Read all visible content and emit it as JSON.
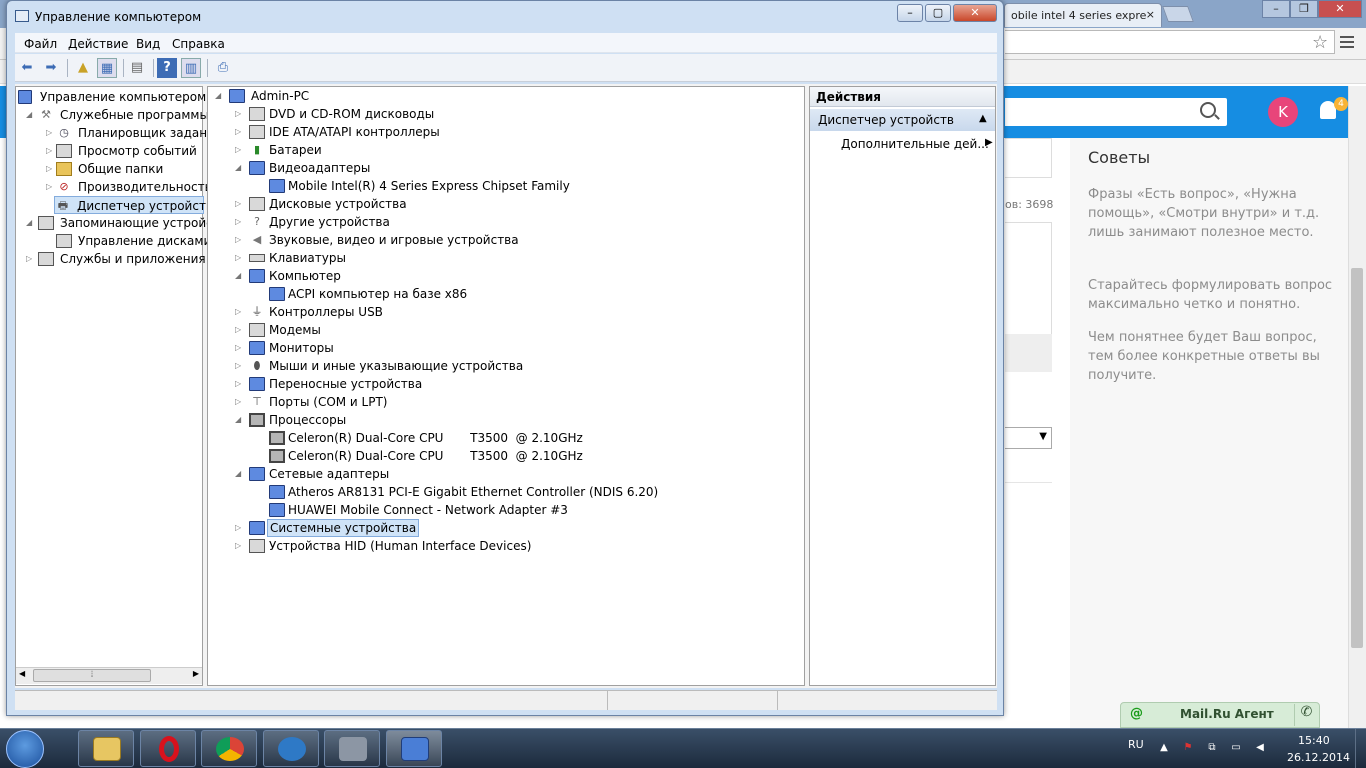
{
  "browser": {
    "tab_text": "obile intel 4 series expre",
    "tab_close": "×"
  },
  "site": {
    "avatar_letter": "K",
    "notification_count": "4",
    "counter_text": "ов: 3698",
    "select_arrow": "▼",
    "tips": {
      "title": "Советы",
      "tip1": "Фразы «Есть вопрос», «Нужна помощь», «Смотри внутри» и т.д. лишь занимают полезное место.",
      "tip2": "Старайтесь формулировать вопрос максимально четко и понятно.",
      "tip3": "Чем понятнее будет Ваш вопрос, тем более конкретные ответы вы получите."
    },
    "agent_label": "Mail.Ru Агент",
    "agent_at": "@"
  },
  "mmc": {
    "title": "Управление компьютером",
    "menu": [
      "Файл",
      "Действие",
      "Вид",
      "Справка"
    ],
    "console_tree": {
      "root": "Управление компьютером (л",
      "utilities": "Служебные программы",
      "task_scheduler": "Планировщик заданий",
      "event_viewer": "Просмотр событий",
      "shared_folders": "Общие папки",
      "performance": "Производительность",
      "device_manager": "Диспетчер устройств",
      "storage": "Запоминающие устройст",
      "disk_management": "Управление дисками",
      "services_apps": "Службы и приложения"
    },
    "device_tree": {
      "root": "Admin-PC",
      "dvd": "DVD и CD-ROM дисководы",
      "ide": "IDE ATA/ATAPI контроллеры",
      "batteries": "Батареи",
      "video": "Видеоадаптеры",
      "video_child": "Mobile Intel(R) 4 Series Express Chipset Family",
      "disks": "Дисковые устройства",
      "other": "Другие устройства",
      "sound": "Звуковые, видео и игровые устройства",
      "keyboards": "Клавиатуры",
      "computer": "Компьютер",
      "computer_child": "ACPI компьютер на базе x86",
      "usb": "Контроллеры USB",
      "modems": "Модемы",
      "monitors": "Мониторы",
      "mice": "Мыши и иные указывающие устройства",
      "portable": "Переносные устройства",
      "ports": "Порты (COM и LPT)",
      "processors": "Процессоры",
      "cpu1": "Celeron(R) Dual-Core CPU       T3500  @ 2.10GHz",
      "cpu2": "Celeron(R) Dual-Core CPU       T3500  @ 2.10GHz",
      "network": "Сетевые адаптеры",
      "net1": "Atheros AR8131 PCI-E Gigabit Ethernet Controller (NDIS 6.20)",
      "net2": "HUAWEI Mobile Connect - Network Adapter #3",
      "system": "Системные устройства",
      "hid": "Устройства HID (Human Interface Devices)"
    },
    "actions": {
      "header": "Действия",
      "section": "Диспетчер устройств",
      "more": "Дополнительные дей..."
    }
  },
  "taskbar": {
    "lang": "RU",
    "time": "15:40",
    "date": "26.12.2014"
  }
}
